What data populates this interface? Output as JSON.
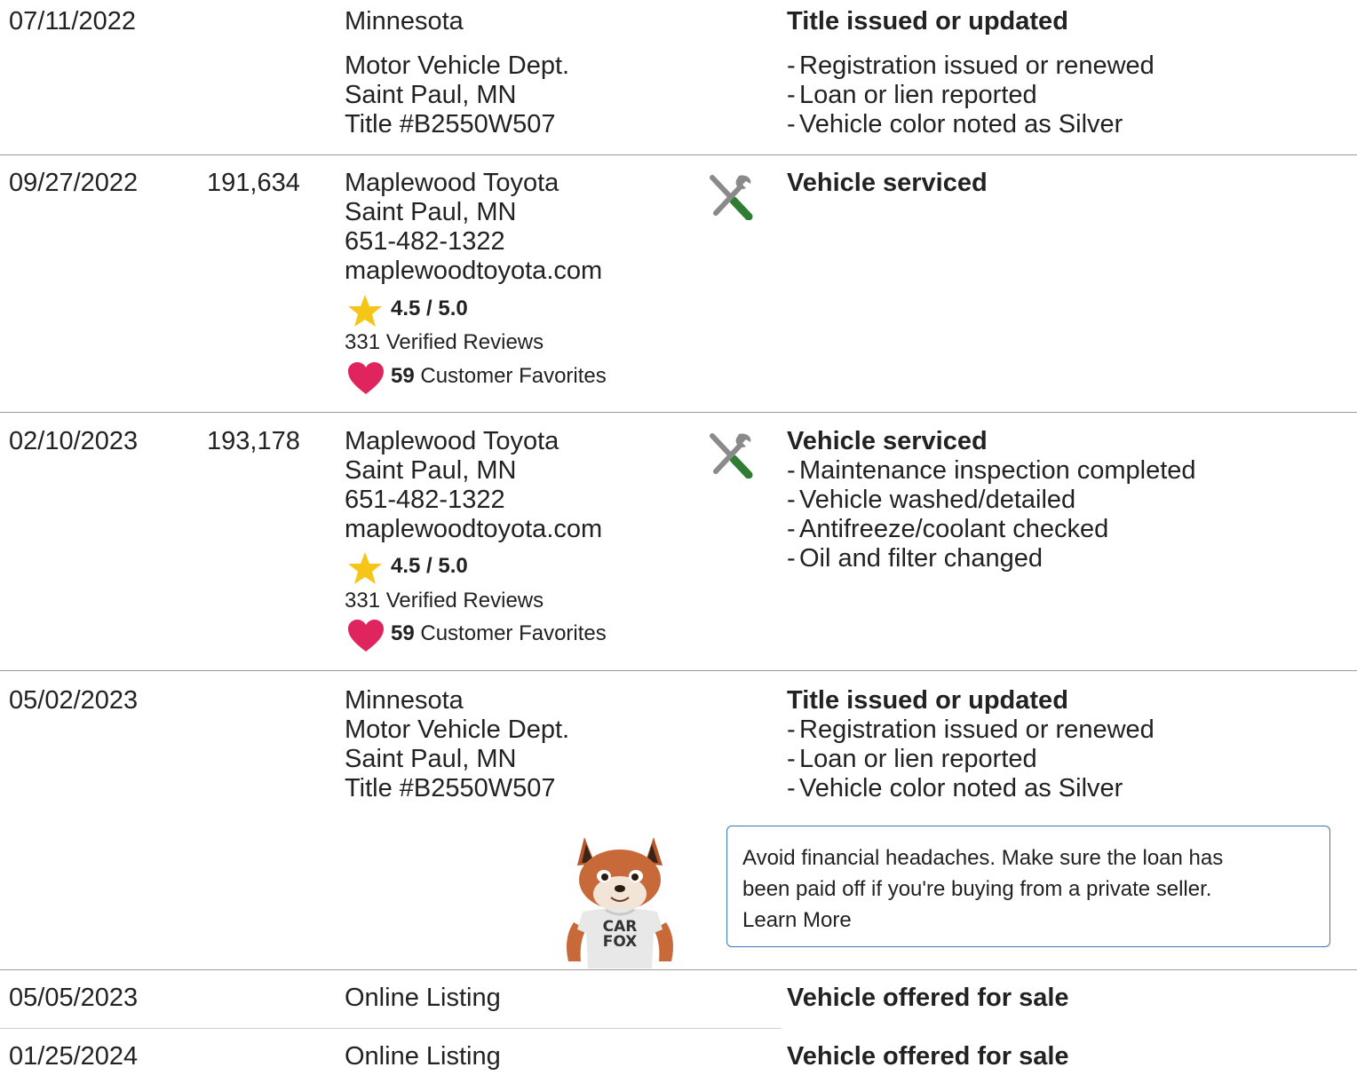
{
  "records": [
    {
      "date": "07/11/2022",
      "odometer": "",
      "source_lines": [
        "Minnesota",
        "Motor Vehicle Dept.",
        "Saint Paul, MN",
        "Title #B2550W507"
      ],
      "event_title": "Title issued or updated",
      "event_details": [
        "Registration issued or renewed",
        "Loan or lien reported",
        "Vehicle color noted as Silver"
      ]
    },
    {
      "date": "09/27/2022",
      "odometer": "191,634",
      "source_lines": [
        "Maplewood Toyota",
        "Saint Paul, MN",
        "651-482-1322",
        "maplewoodtoyota.com"
      ],
      "rating": "4.5 / 5.0",
      "reviews": "331 Verified Reviews",
      "favorites_count": "59",
      "favorites_label": "Customer Favorites",
      "icon": "service-tools-icon",
      "event_title": "Vehicle serviced",
      "event_details": []
    },
    {
      "date": "02/10/2023",
      "odometer": "193,178",
      "source_lines": [
        "Maplewood Toyota",
        "Saint Paul, MN",
        "651-482-1322",
        "maplewoodtoyota.com"
      ],
      "rating": "4.5 / 5.0",
      "reviews": "331 Verified Reviews",
      "favorites_count": "59",
      "favorites_label": "Customer Favorites",
      "icon": "service-tools-icon",
      "event_title": "Vehicle serviced",
      "event_details": [
        "Maintenance inspection completed",
        "Vehicle washed/detailed",
        "Antifreeze/coolant checked",
        "Oil and filter changed"
      ]
    },
    {
      "date": "05/02/2023",
      "odometer": "",
      "source_lines": [
        "Minnesota",
        "Motor Vehicle Dept.",
        "Saint Paul, MN",
        "Title #B2550W507"
      ],
      "event_title": "Title issued or updated",
      "event_details": [
        "Registration issued or renewed",
        "Loan or lien reported",
        "Vehicle color noted as Silver"
      ],
      "callout_line1": "Avoid financial headaches. Make sure the loan has",
      "callout_line2": "been paid off if you're buying from a private seller.",
      "callout_link": "Learn More",
      "mascot_shirt_line1": "CAR",
      "mascot_shirt_line2": "FOX"
    },
    {
      "date": "05/05/2023",
      "odometer": "",
      "source_lines": [
        "Online Listing"
      ],
      "event_title": "Vehicle offered for sale",
      "event_details": []
    },
    {
      "date": "01/25/2024",
      "odometer": "",
      "source_lines": [
        "Online Listing"
      ],
      "event_title": "Vehicle offered for sale",
      "event_details": []
    }
  ],
  "colors": {
    "text": "#222222",
    "divider": "#9a9a9a",
    "callout_border": "#3777bc",
    "star": "#f5c518",
    "heart": "#e0245e",
    "tool_gray": "#8a8a8a",
    "tool_green": "#2e7d32"
  }
}
